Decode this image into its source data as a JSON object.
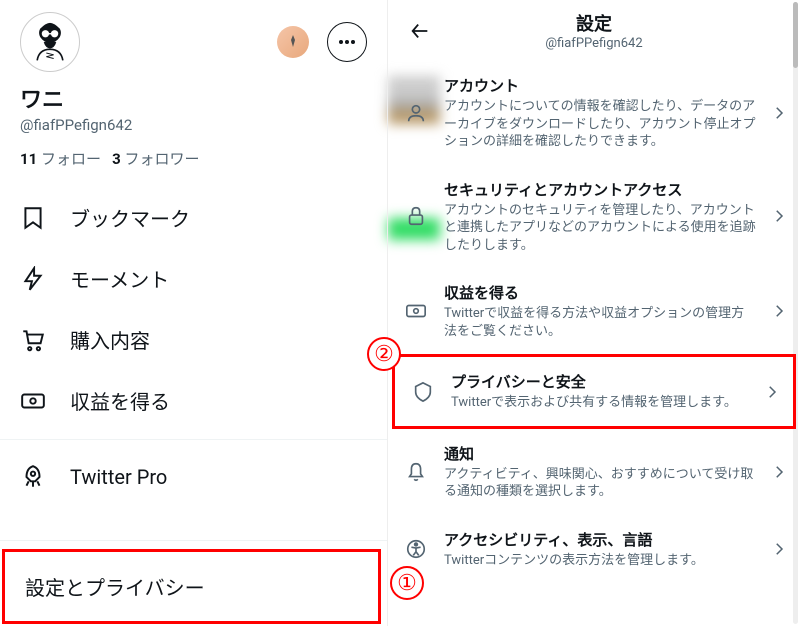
{
  "left": {
    "display_name": "ワニ",
    "handle": "@fiafPPefign642",
    "following_count": "11",
    "following_label": "フォロー",
    "followers_count": "3",
    "followers_label": "フォロワー",
    "nav": [
      {
        "label": "ブックマーク"
      },
      {
        "label": "モーメント"
      },
      {
        "label": "購入内容"
      },
      {
        "label": "収益を得る"
      }
    ],
    "twitter_pro": "Twitter Pro",
    "settings_privacy": "設定とプライバシー"
  },
  "right": {
    "title": "設定",
    "subtitle": "@fiafPPefign642",
    "items": [
      {
        "title": "アカウント",
        "desc": "アカウントについての情報を確認したり、データのアーカイブをダウンロードしたり、アカウント停止オプションの詳細を確認したりできます。"
      },
      {
        "title": "セキュリティとアカウントアクセス",
        "desc": "アカウントのセキュリティを管理したり、アカウントと連携したアプリなどのアカウントによる使用を追跡したりします。"
      },
      {
        "title": "収益を得る",
        "desc": "Twitterで収益を得る方法や収益オプションの管理方法をご覧ください。"
      },
      {
        "title": "プライバシーと安全",
        "desc": "Twitterで表示および共有する情報を管理します。"
      },
      {
        "title": "通知",
        "desc": "アクティビティ、興味関心、おすすめについて受け取る通知の種類を選択します。"
      },
      {
        "title": "アクセシビリティ、表示、言語",
        "desc": "Twitterコンテンツの表示方法を管理します。"
      }
    ]
  },
  "annotations": {
    "one": "①",
    "two": "②"
  }
}
